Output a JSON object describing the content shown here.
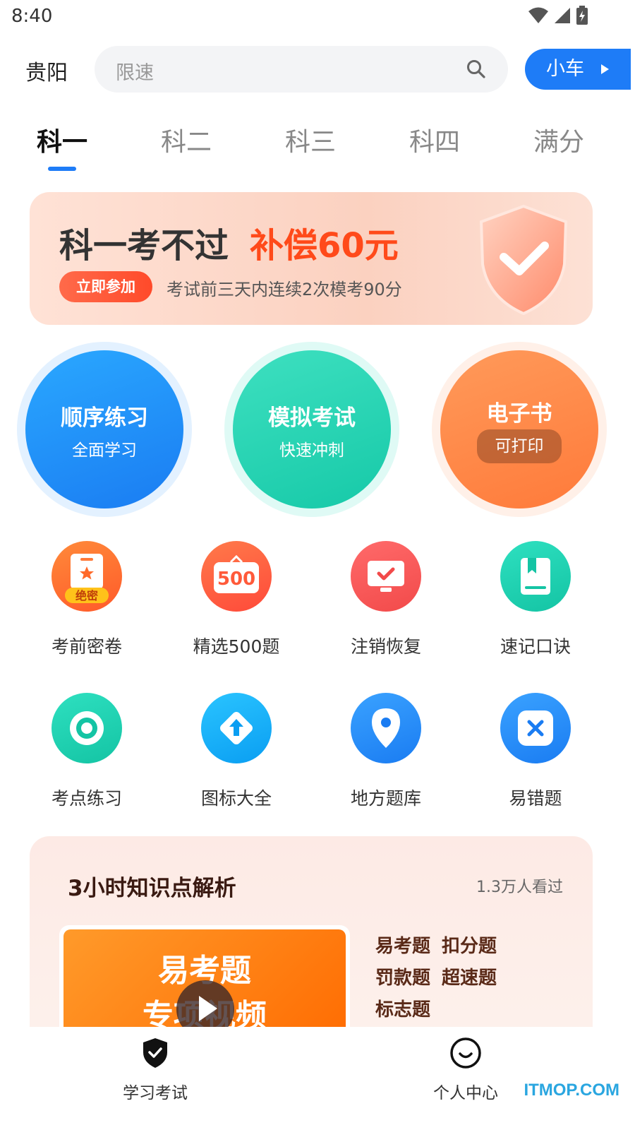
{
  "status_bar": {
    "time": "8:40"
  },
  "header": {
    "city": "贵阳",
    "search_placeholder": "限速",
    "car_button": "小车"
  },
  "tabs": [
    {
      "label": "科一",
      "active": true
    },
    {
      "label": "科二",
      "active": false
    },
    {
      "label": "科三",
      "active": false
    },
    {
      "label": "科四",
      "active": false
    },
    {
      "label": "满分",
      "active": false
    }
  ],
  "banner": {
    "title": "科一考不过",
    "highlight": "补偿60元",
    "join_label": "立即参加",
    "subtitle": "考试前三天内连续2次模考90分"
  },
  "main_actions": [
    {
      "title": "顺序练习",
      "subtitle": "全面学习",
      "color": "#1e8ff7"
    },
    {
      "title": "模拟考试",
      "subtitle": "快速冲刺",
      "color": "#1fd1b4"
    },
    {
      "title": "电子书",
      "subtitle": "可打印",
      "color": "#ff8a4a"
    }
  ],
  "grid": [
    {
      "label": "考前密卷",
      "icon": "secret-paper-icon",
      "badge": "绝密"
    },
    {
      "label": "精选500题",
      "icon": "500-questions-icon",
      "badge": "500"
    },
    {
      "label": "注销恢复",
      "icon": "monitor-check-icon"
    },
    {
      "label": "速记口诀",
      "icon": "book-icon"
    },
    {
      "label": "考点练习",
      "icon": "target-icon"
    },
    {
      "label": "图标大全",
      "icon": "road-sign-icon"
    },
    {
      "label": "地方题库",
      "icon": "location-pin-icon"
    },
    {
      "label": "易错题",
      "icon": "wrong-mark-icon"
    }
  ],
  "knowledge_card": {
    "title": "3小时知识点解析",
    "views": "1.3万人看过",
    "video_lines": [
      "易考题",
      "专项视频"
    ],
    "tags": [
      "易考题",
      "扣分题",
      "罚款题",
      "超速题",
      "标志题"
    ]
  },
  "bottom_nav": [
    {
      "label": "学习考试",
      "icon": "shield-check-icon",
      "active": true
    },
    {
      "label": "个人中心",
      "icon": "smile-face-icon",
      "active": false
    }
  ],
  "watermark": "ITMOP.COM"
}
